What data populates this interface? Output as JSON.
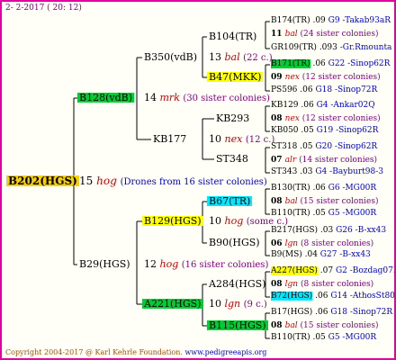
{
  "header": {
    "date": "2-  2-2017 ( 20: 12)"
  },
  "footer": {
    "copyright": "Copyright 2004-2017 @ Karl Kehrle Foundation.",
    "url": "www.pedigreeapis.org"
  },
  "root": {
    "name": "B202(HGS)",
    "num": "15",
    "code": "hog",
    "note": "(Drones from 16 sister colonies)"
  },
  "gen1": {
    "upper": {
      "name": "B128(vdB)",
      "num": "14",
      "code": "mrk",
      "note": "(30 sister colonies)"
    },
    "lower": {
      "name": "B29(HGS)",
      "num": "12",
      "code": "hog",
      "note": "(16 sister colonies)"
    }
  },
  "gen2": {
    "a": {
      "name": "B350(vdB)",
      "num": "13",
      "code": "bal",
      "note": "(22 c.)"
    },
    "b": {
      "name": "KB177",
      "num": "10",
      "code": "nex",
      "note": "(12 c.)"
    },
    "c": {
      "name": "B129(HGS)",
      "num": "10",
      "code": "hog",
      "note": "(some c.)"
    },
    "d": {
      "name": "A221(HGS)",
      "num": "10",
      "code": "lgn",
      "note": "(9 c.)"
    }
  },
  "gen3": {
    "a": {
      "name": "B104(TR)"
    },
    "b": {
      "name": "B47(MKK)"
    },
    "c": {
      "name": "KB293"
    },
    "d": {
      "name": "ST348"
    },
    "e": {
      "name": "B67(TR)"
    },
    "f": {
      "name": "B90(HGS)"
    },
    "g": {
      "name": "A284(HGS)"
    },
    "h": {
      "name": "B115(HGS)"
    }
  },
  "gen4": [
    {
      "name": "B174(TR)",
      "num": ".09",
      "ref": "G9 -Takab93aR"
    },
    {
      "num": "11",
      "code": "bal",
      "note": "(24 sister colonies)"
    },
    {
      "name": "GR109(TR)",
      "num": ".093",
      "ref": "-Gr.Rmounta"
    },
    {
      "name": "B171(TR)",
      "num": ".06",
      "ref": "G22 -Sinop62R"
    },
    {
      "num": "09",
      "code": "nex",
      "note": "(12 sister colonies)"
    },
    {
      "name": "PS596",
      "num": ".06",
      "ref": "G18 -Sinop72R"
    },
    {
      "name": "KB129",
      "num": ".06",
      "ref": "G4 -Ankar02Q"
    },
    {
      "num": "08",
      "code": "nex",
      "note": "(12 sister colonies)"
    },
    {
      "name": "KB050",
      "num": ".05",
      "ref": "G19 -Sinop62R"
    },
    {
      "name": "ST318",
      "num": ".05",
      "ref": "G20 -Sinop62R"
    },
    {
      "num": "07",
      "code": "alr",
      "note": "(14 sister colonies)"
    },
    {
      "name": "ST343",
      "num": ".03",
      "ref": "G4 -Bayburt98-3"
    },
    {
      "name": "B130(TR)",
      "num": ".06",
      "ref": "G6 -MG00R"
    },
    {
      "num": "08",
      "code": "bal",
      "note": "(15 sister colonies)"
    },
    {
      "name": "B110(TR)",
      "num": ".05",
      "ref": "G5 -MG00R"
    },
    {
      "name": "B217(HGS)",
      "num": ".03",
      "ref": "G26 -B-xx43"
    },
    {
      "num": "06",
      "code": "lgn",
      "note": "(8 sister colonies)"
    },
    {
      "name": "B9(MS)",
      "num": ".04",
      "ref": "G27 -B-xx43"
    },
    {
      "name": "A227(HGS)",
      "num": ".07",
      "ref": "G2 -Bozdag07R"
    },
    {
      "num": "08",
      "code": "lgn",
      "note": "(8 sister colonies)"
    },
    {
      "name": "B72(HGS)",
      "num": ".06",
      "ref": "G14 -AthosSt80R"
    },
    {
      "name": "B17(HGS)",
      "num": ".06",
      "ref": "G18 -Sinop72R"
    },
    {
      "num": "08",
      "code": "bal",
      "note": "(15 sister colonies)"
    },
    {
      "name": "B110(TR)",
      "num": ".05",
      "ref": "G5 -MG00R"
    }
  ]
}
